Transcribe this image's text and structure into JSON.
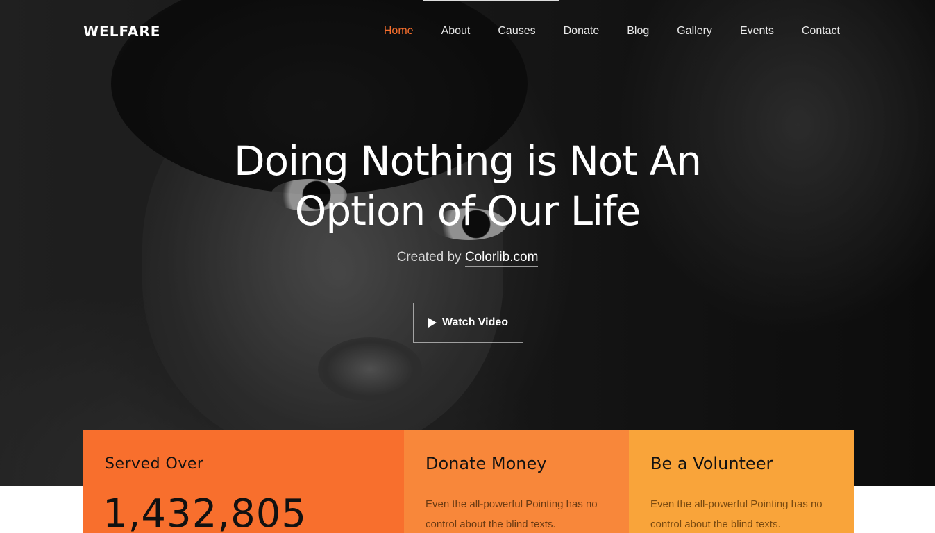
{
  "brand": "WELFARE",
  "nav": {
    "items": [
      "Home",
      "About",
      "Causes",
      "Donate",
      "Blog",
      "Gallery",
      "Events",
      "Contact"
    ],
    "active": "Home"
  },
  "hero": {
    "title_line1": "Doing Nothing is Not An",
    "title_line2": "Option of Our Life",
    "credit_prefix": "Created by",
    "credit_link": "Colorlib.com",
    "watch_video": "Watch Video"
  },
  "cards": {
    "served": {
      "title": "Served Over",
      "count": "1,432,805"
    },
    "donate": {
      "title": "Donate Money",
      "text": "Even the all-powerful Pointing has no control about the blind texts."
    },
    "volunteer": {
      "title": "Be a Volunteer",
      "text": "Even the all-powerful Pointing has no control about the blind texts."
    }
  },
  "colors": {
    "accent": "#f86f2d",
    "card_served": "#f86f2d",
    "card_donate": "#f8873a",
    "card_volunteer": "#f9a43a"
  }
}
